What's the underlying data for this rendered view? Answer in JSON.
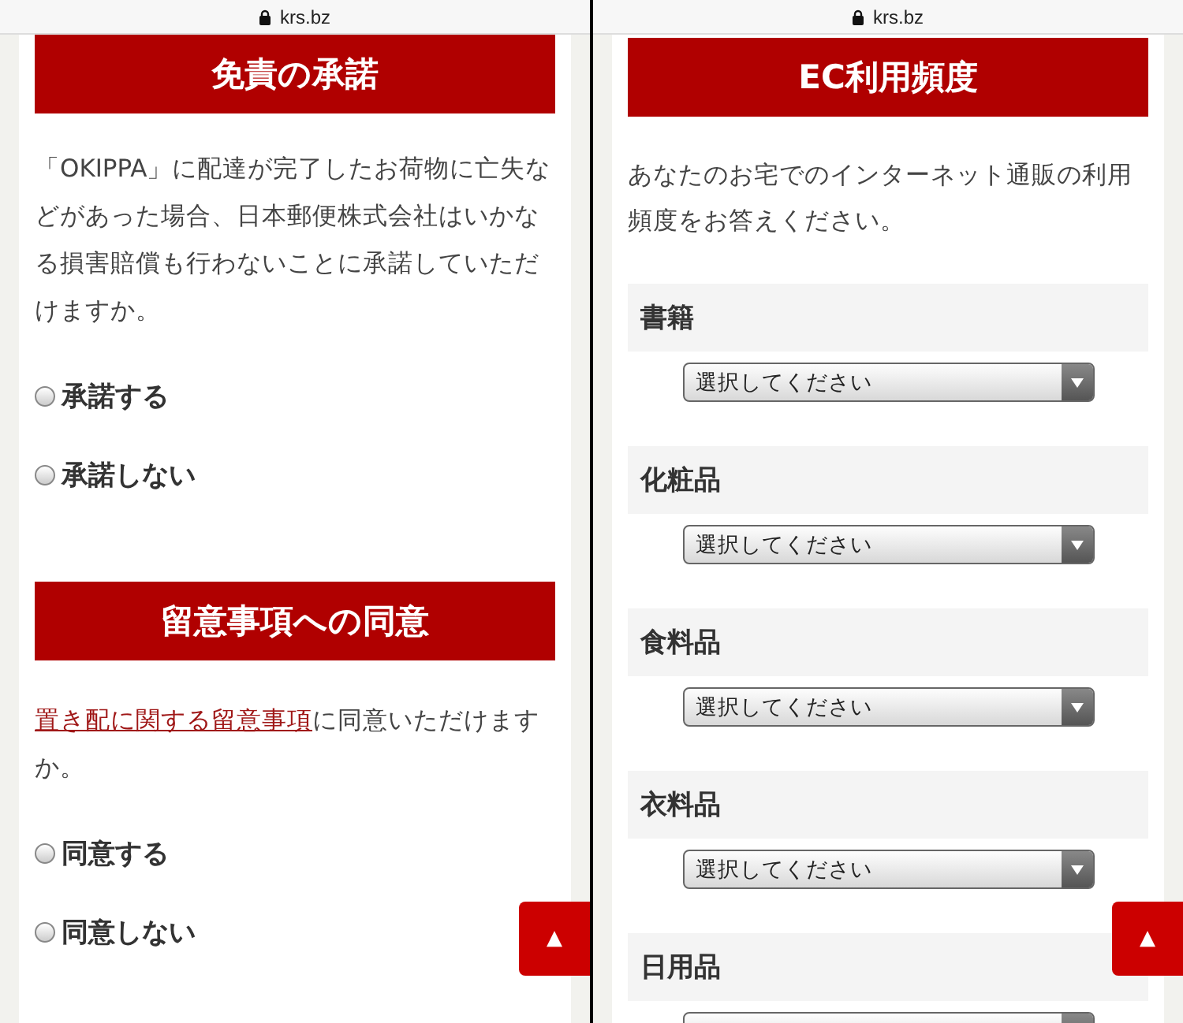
{
  "panels": [
    {
      "address": "krs.bz",
      "kind": "consent",
      "back_to_top": "▲",
      "sections": [
        {
          "heading": "免責の承諾",
          "text": "「OKIPPA」に配達が完了したお荷物に亡失などがあった場合、日本郵便株式会社はいかなる損害賠償も行わないことに承諾していただけますか。",
          "options": [
            {
              "label": "承諾する",
              "selected": false
            },
            {
              "label": "承諾しない",
              "selected": false
            }
          ]
        },
        {
          "heading": "留意事項への同意",
          "link": "置き配に関する留意事項",
          "text": "に同意いただけますか。",
          "options": [
            {
              "label": "同意する",
              "selected": false
            },
            {
              "label": "同意しない",
              "selected": false
            }
          ]
        }
      ]
    },
    {
      "address": "krs.bz",
      "kind": "frequency",
      "back_to_top": "▲",
      "heading": "EC利用頻度",
      "text": "あなたのお宅でのインターネット通販の利用頻度をお答えください。",
      "categories": [
        {
          "label": "書籍",
          "select": "選択してください"
        },
        {
          "label": "化粧品",
          "select": "選択してください"
        },
        {
          "label": "食料品",
          "select": "選択してください"
        },
        {
          "label": "衣料品",
          "select": "選択してください"
        },
        {
          "label": "日用品"
        }
      ]
    }
  ]
}
